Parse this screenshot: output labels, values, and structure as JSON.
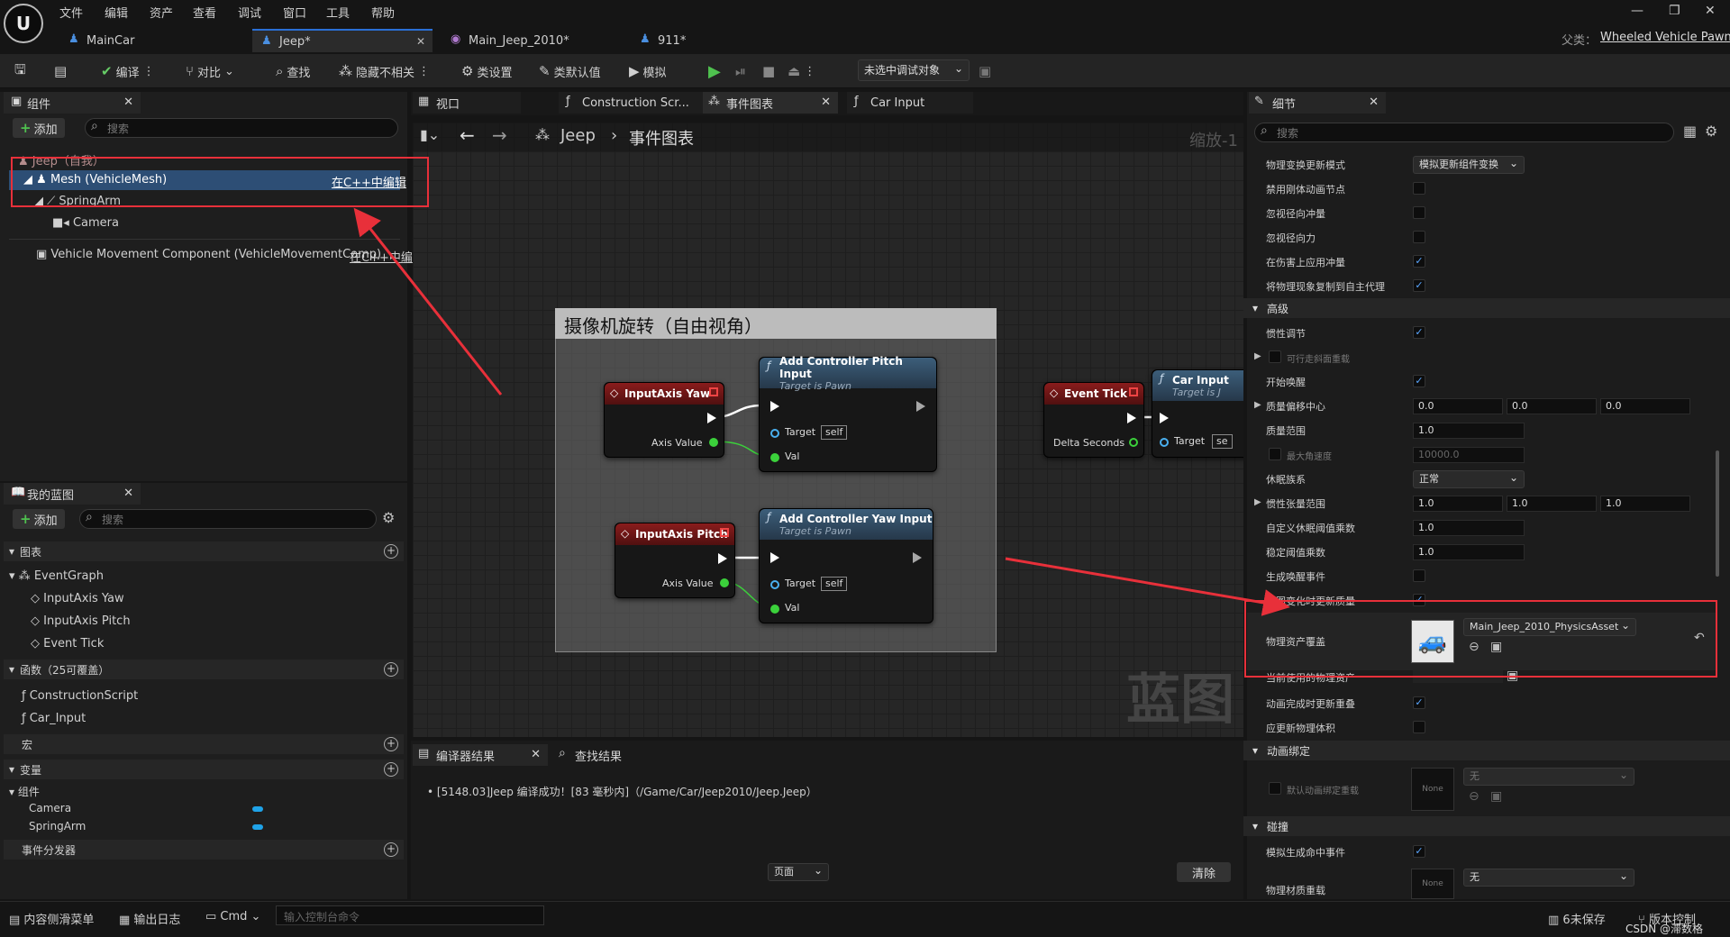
{
  "menu": [
    "文件",
    "编辑",
    "资产",
    "查看",
    "调试",
    "窗口",
    "工具",
    "帮助"
  ],
  "tabs": [
    {
      "label": "MainCar"
    },
    {
      "label": "Jeep*"
    },
    {
      "label": "Main_Jeep_2010*"
    },
    {
      "label": "911*"
    }
  ],
  "parent_class": {
    "label": "父类：",
    "value": "Wheeled Vehicle Pawn"
  },
  "toolbar": {
    "compile": "编译",
    "diff": "对比",
    "find": "查找",
    "hide": "隐藏不相关",
    "class_settings": "类设置",
    "class_defaults": "类默认值",
    "simulate": "模拟",
    "debug_target": "未选中调试对象"
  },
  "components": {
    "tab": "组件",
    "add": "添加",
    "search_placeholder": "搜索",
    "root": "Jeep（自我）",
    "mesh": "Mesh (VehicleMesh)",
    "mesh_edit": "在C++中编辑",
    "spring_arm": "SpringArm",
    "camera": "Camera",
    "vmc": "Vehicle Movement Component (VehicleMovementComp)",
    "vmc_edit": "在C++中编"
  },
  "my_blueprint": {
    "tab": "我的蓝图",
    "add": "添加",
    "search_placeholder": "搜索",
    "graphs_section": "图表",
    "event_graph": "EventGraph",
    "events": [
      "InputAxis Yaw",
      "InputAxis Pitch",
      "Event Tick"
    ],
    "functions_section": "函数（25可覆盖）",
    "functions": [
      "ConstructionScript",
      "Car_Input"
    ],
    "macros_section": "宏",
    "variables_section": "变量",
    "components_group": "组件",
    "vars": [
      "Camera",
      "SpringArm"
    ],
    "dispatchers_section": "事件分发器"
  },
  "editor_tabs": {
    "viewport": "视口",
    "construction": "Construction Scr...",
    "event_graph": "事件图表",
    "car_input": "Car Input"
  },
  "breadcrumb": {
    "root": "Jeep",
    "current": "事件图表",
    "zoom": "缩放-1"
  },
  "graph": {
    "comment": "摄像机旋转（自由视角）",
    "watermark": "蓝图",
    "nodes": {
      "yaw": {
        "title": "InputAxis Yaw",
        "out": "Axis Value"
      },
      "pitch_in": {
        "title": "InputAxis Pitch",
        "out": "Axis Value"
      },
      "add_pitch": {
        "title": "Add Controller Pitch Input",
        "sub": "Target is Pawn",
        "target": "Target",
        "self": "self",
        "val": "Val"
      },
      "add_yaw": {
        "title": "Add Controller Yaw Input",
        "sub": "Target is Pawn",
        "target": "Target",
        "self": "self",
        "val": "Val"
      },
      "tick": {
        "title": "Event Tick",
        "out": "Delta Seconds"
      },
      "car_input": {
        "title": "Car Input",
        "sub": "Target is J",
        "target": "Target",
        "self": "se"
      }
    }
  },
  "output": {
    "tab_compiler": "编译器结果",
    "tab_find": "查找结果",
    "log": "[5148.03]Jeep 编译成功！[83 毫秒内]（/Game/Car/Jeep2010/Jeep.Jeep）",
    "page": "页面",
    "clear": "清除"
  },
  "details": {
    "tab": "细节",
    "search_placeholder": "搜索",
    "props_top": [
      {
        "label": "物理变换更新模式",
        "type": "dropdown",
        "value": "模拟更新组件变换"
      },
      {
        "label": "禁用刚体动画节点",
        "type": "check",
        "checked": false
      },
      {
        "label": "忽视径向冲量",
        "type": "check",
        "checked": false
      },
      {
        "label": "忽视径向力",
        "type": "check",
        "checked": false
      },
      {
        "label": "在伤害上应用冲量",
        "type": "check",
        "checked": true
      },
      {
        "label": "将物理现象复制到自主代理",
        "type": "check",
        "checked": true
      }
    ],
    "advanced": "高级",
    "inertia_cond": "惯性调节",
    "walkable": "可行走斜面重载",
    "start_awake": "开始唤醒",
    "com_offset": "质量偏移中心",
    "com_vals": [
      "0.0",
      "0.0",
      "0.0"
    ],
    "mass_scale": "质量范围",
    "mass_scale_val": "1.0",
    "max_ang_vel": "最大角速度",
    "max_ang_vel_val": "10000.0",
    "sleep_family": "休眠族系",
    "sleep_family_val": "正常",
    "inertia_scale": "惯性张量范围",
    "inertia_vals": [
      "1.0",
      "1.0",
      "1.0"
    ],
    "custom_sleep": "自定义休眠阈值乘数",
    "custom_sleep_val": "1.0",
    "stab_mult": "稳定阈值乘数",
    "stab_mult_val": "1.0",
    "gen_wake": "生成唤醒事件",
    "update_mass": "全图变化时更新质量",
    "phys_override": "物理资产覆盖",
    "phys_asset": "Main_Jeep_2010_PhysicsAsset",
    "current_phys": "当前使用的物理资产",
    "anim_update": "动画完成时更新重叠",
    "update_phys_vol": "应更新物理体积",
    "anim_bind": "动画绑定",
    "default_anim": "默认动画绑定重载",
    "none": "None",
    "none_cn": "无",
    "collision": "碰撞",
    "sim_hit": "模拟生成命中事件",
    "phys_mat": "物理材质重载"
  },
  "statusbar": {
    "content": "内容侧滑菜单",
    "log": "输出日志",
    "cmd": "Cmd",
    "console_placeholder": "输入控制台命令",
    "unsaved": "6未保存",
    "version": "版本控制",
    "credit": "CSDN @滞数格"
  }
}
